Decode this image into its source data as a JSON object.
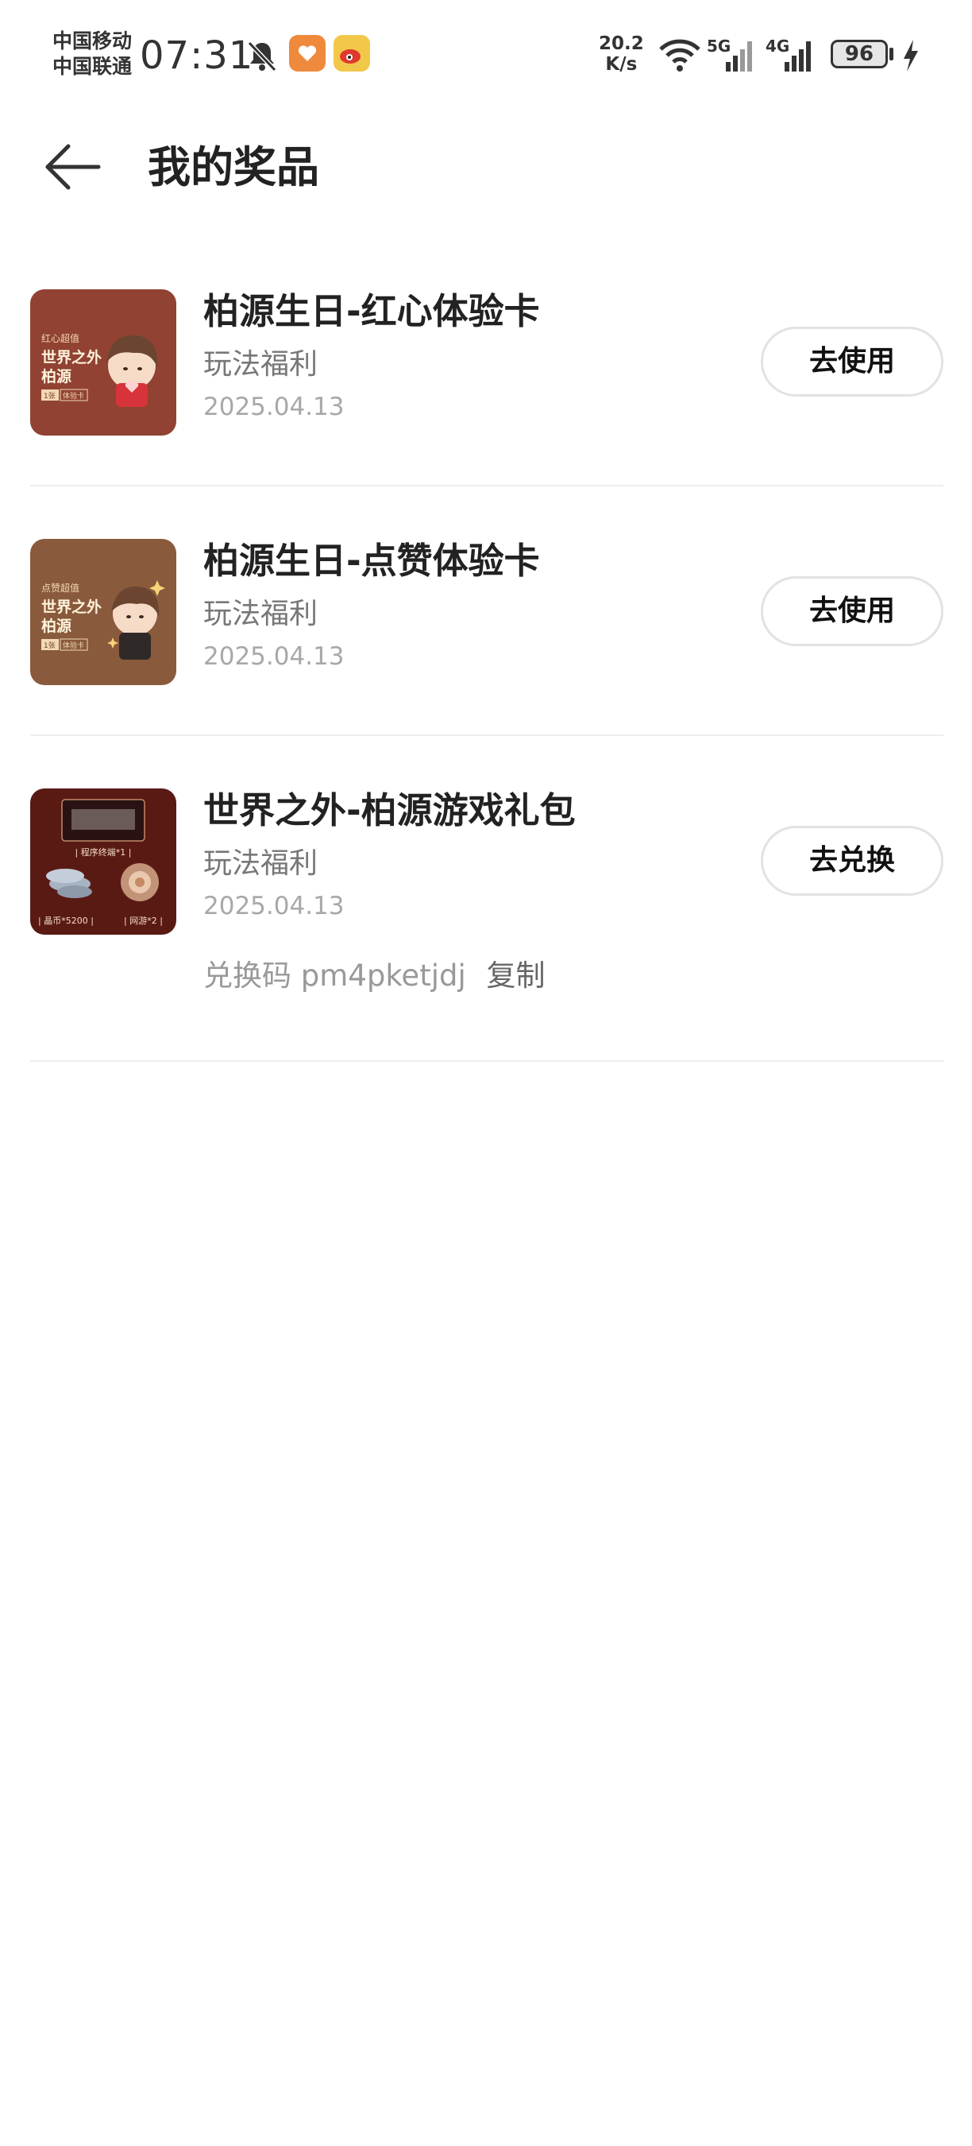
{
  "status_bar": {
    "carrier_1": "中国移动",
    "carrier_2": "中国联通",
    "time": "07:31",
    "net_speed_value": "20.2",
    "net_speed_unit": "K/s",
    "signal_1_label": "5G",
    "signal_2_label": "4G",
    "battery": "96",
    "icons": [
      "bell-muted-icon",
      "app-notification-icon",
      "weibo-icon",
      "wifi-icon",
      "signal-icon",
      "charging-icon"
    ]
  },
  "header": {
    "title": "我的奖品",
    "back_icon": "arrow-left-icon"
  },
  "prizes": [
    {
      "title": "柏源生日-红心体验卡",
      "category": "玩法福利",
      "date": "2025.04.13",
      "action": "去使用",
      "thumb_label_top": "红心超值",
      "thumb_label_main_1": "世界之外",
      "thumb_label_main_2": "柏源",
      "thumb_tag_1": "1张",
      "thumb_tag_2": "体验卡"
    },
    {
      "title": "柏源生日-点赞体验卡",
      "category": "玩法福利",
      "date": "2025.04.13",
      "action": "去使用",
      "thumb_label_top": "点赞超值",
      "thumb_label_main_1": "世界之外",
      "thumb_label_main_2": "柏源",
      "thumb_tag_1": "1张",
      "thumb_tag_2": "体验卡"
    },
    {
      "title": "世界之外-柏源游戏礼包",
      "category": "玩法福利",
      "date": "2025.04.13",
      "action": "去兑换",
      "code_label": "兑换码",
      "code_value": "pm4pketjdj",
      "copy_label": "复制",
      "thumb_item_1": "| 程序终端*1 |",
      "thumb_item_2": "| 晶币*5200 |",
      "thumb_item_3": "| 网游*2 |"
    }
  ],
  "colors": {
    "thumb_red": "#9b4a3a",
    "thumb_brown": "#8a5a3c",
    "thumb_dark": "#5a1a14",
    "divider": "#ededed",
    "button_border": "#e2e2e2"
  }
}
